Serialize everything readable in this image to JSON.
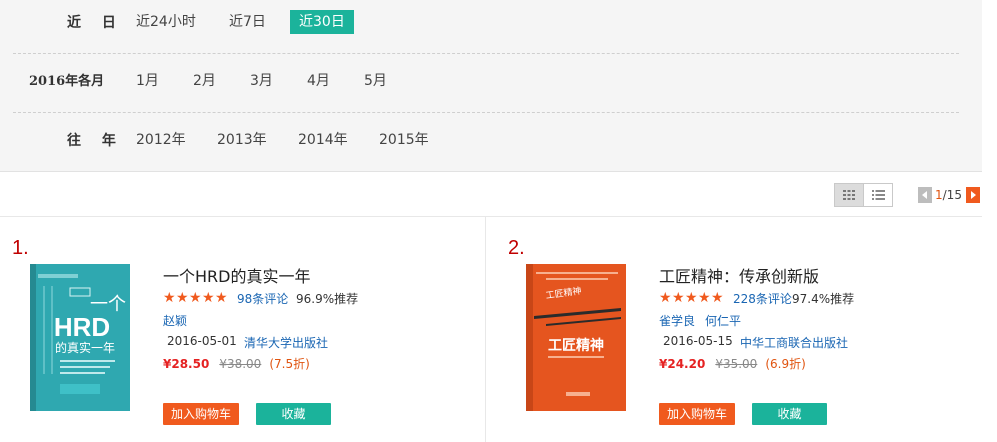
{
  "filters": {
    "recent": {
      "label": "近 日",
      "options": [
        "近24小时",
        "近7日",
        "近30日"
      ]
    },
    "months": {
      "label": "2016年各月",
      "options": [
        "1月",
        "2月",
        "3月",
        "4月",
        "5月"
      ]
    },
    "years": {
      "label": "往 年",
      "options": [
        "2012年",
        "2013年",
        "2014年",
        "2015年"
      ]
    }
  },
  "pager": {
    "current": "1",
    "total": "/15"
  },
  "products": [
    {
      "rank": "1.",
      "title": "一个HRD的真实一年",
      "rating_stars": 5,
      "reviews": "98条评论",
      "recommend": "96.9%推荐",
      "authors": [
        "赵颖"
      ],
      "date": "2016-05-01",
      "publisher": "清华大学出版社",
      "price": "¥28.50",
      "original_price": "¥38.00",
      "discount": "(7.5折)",
      "cart_label": "加入购物车",
      "fav_label": "收藏",
      "cover": {
        "color": "#2fa8b0",
        "title": "HRD",
        "subtitle": "的真实一年",
        "top": "一个"
      }
    },
    {
      "rank": "2.",
      "title": "工匠精神：传承创新版",
      "rating_stars": 5,
      "reviews": "228条评论",
      "recommend": "97.4%推荐",
      "authors": [
        "雀学良",
        "何仁平"
      ],
      "date": "2016-05-15",
      "publisher": "中华工商联合出版社",
      "price": "¥24.20",
      "original_price": "¥35.00",
      "discount": "(6.9折)",
      "cart_label": "加入购物车",
      "fav_label": "收藏",
      "cover": {
        "color": "#e5551f",
        "title": "工匠精神"
      }
    }
  ],
  "colors": {
    "accent": "#1bb39b",
    "cart": "#f05a1e",
    "price": "#e52222",
    "link": "#1a66b3"
  }
}
